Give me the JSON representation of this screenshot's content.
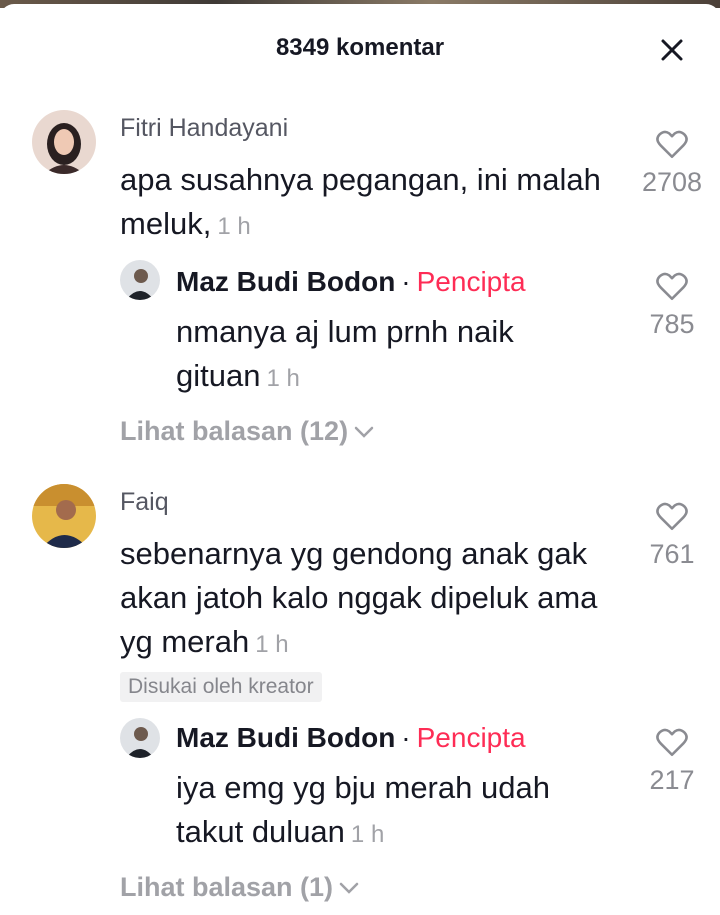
{
  "header": {
    "title": "8349 komentar",
    "close_icon": "close-icon"
  },
  "colors": {
    "creator_accent": "#fe2c55",
    "secondary_text": "#a1a2a7"
  },
  "comments": [
    {
      "username": "Fitri Handayani",
      "text": "apa susahnya pegangan, ini malah meluk,",
      "time": "1 h",
      "likes": "2708",
      "reply": {
        "username": "Maz Budi Bodon",
        "separator": "·",
        "creator_label": "Pencipta",
        "text": "nmanya aj lum prnh naik gituan",
        "time": "1 h",
        "likes": "785"
      },
      "view_replies": "Lihat balasan (12)"
    },
    {
      "username": "Faiq",
      "text": "sebenarnya yg gendong anak gak akan jatoh kalo nggak dipeluk ama yg merah",
      "time": "1 h",
      "likes": "761",
      "badge": "Disukai oleh kreator",
      "reply": {
        "username": "Maz Budi Bodon",
        "separator": "·",
        "creator_label": "Pencipta",
        "text": "iya emg yg bju merah udah takut duluan",
        "time": "1 h",
        "likes": "217"
      },
      "view_replies": "Lihat balasan (1)"
    }
  ]
}
